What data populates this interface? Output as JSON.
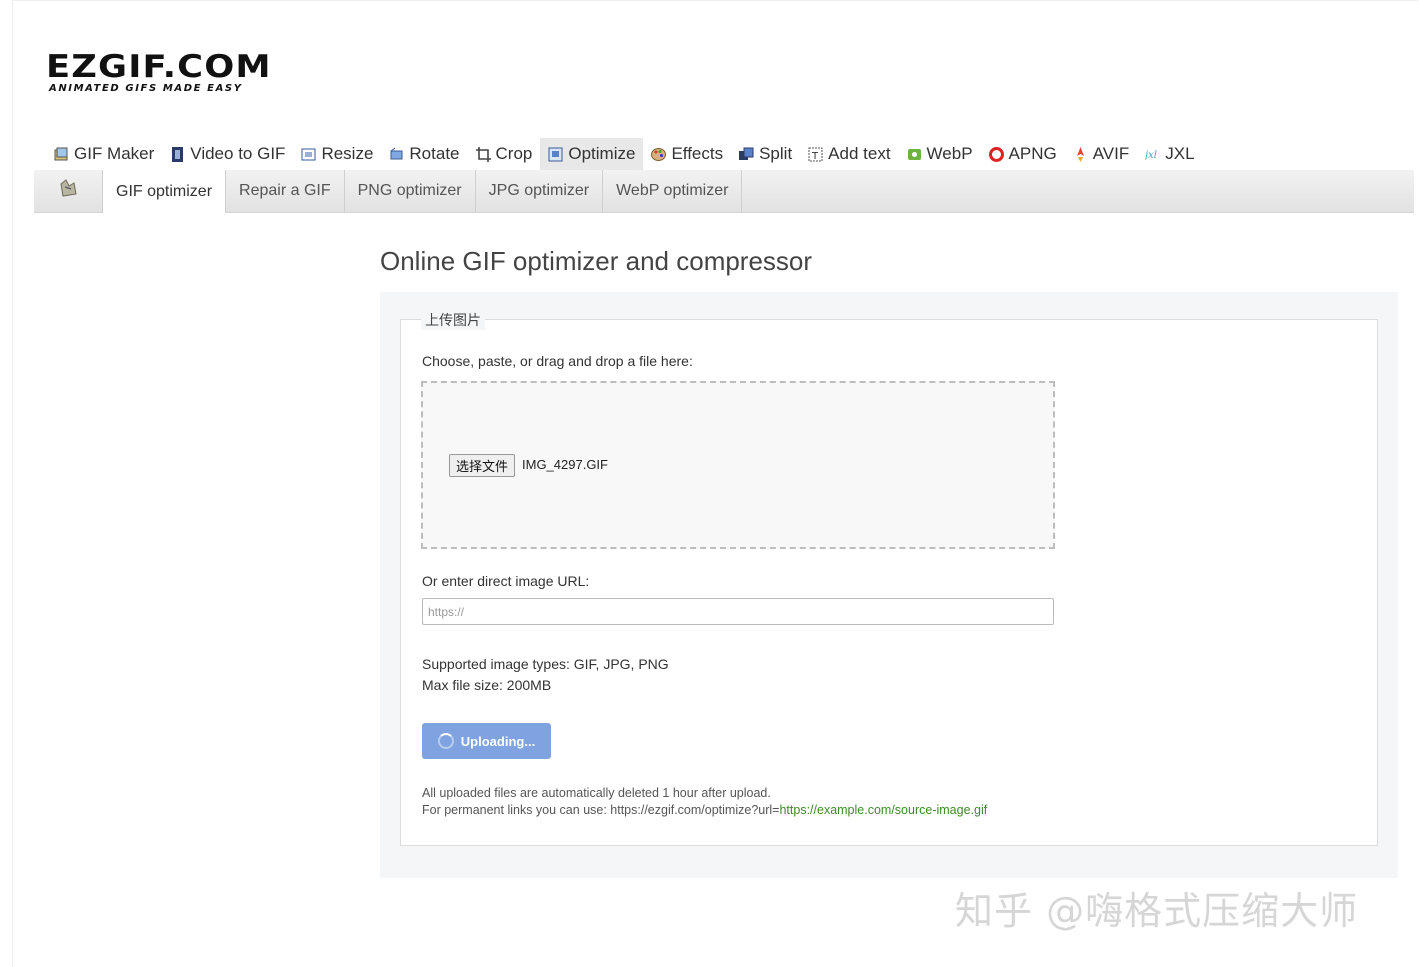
{
  "logo": {
    "main": "EZGIF.COM",
    "sub": "ANIMATED GIFS MADE EASY"
  },
  "nav": [
    {
      "label": "GIF Maker",
      "icon": "gif-maker-icon"
    },
    {
      "label": "Video to GIF",
      "icon": "film-icon"
    },
    {
      "label": "Resize",
      "icon": "resize-icon"
    },
    {
      "label": "Rotate",
      "icon": "rotate-icon"
    },
    {
      "label": "Crop",
      "icon": "crop-icon"
    },
    {
      "label": "Optimize",
      "icon": "optimize-icon",
      "active": true
    },
    {
      "label": "Effects",
      "icon": "palette-icon"
    },
    {
      "label": "Split",
      "icon": "split-icon"
    },
    {
      "label": "Add text",
      "icon": "add-text-icon"
    },
    {
      "label": "WebP",
      "icon": "webp-icon"
    },
    {
      "label": "APNG",
      "icon": "apng-icon"
    },
    {
      "label": "AVIF",
      "icon": "avif-icon"
    },
    {
      "label": "JXL",
      "icon": "jxl-icon"
    }
  ],
  "subnav": [
    {
      "label": "GIF optimizer",
      "active": true
    },
    {
      "label": "Repair a GIF"
    },
    {
      "label": "PNG optimizer"
    },
    {
      "label": "JPG optimizer"
    },
    {
      "label": "WebP optimizer"
    }
  ],
  "page_title": "Online GIF optimizer and compressor",
  "form": {
    "legend": "上传图片",
    "choose_label": "Choose, paste, or drag and drop a file here:",
    "file_button": "选择文件",
    "file_name": "IMG_4297.GIF",
    "url_label": "Or enter direct image URL:",
    "url_placeholder": "https://",
    "supported": "Supported image types: GIF, JPG, PNG",
    "max_size": "Max file size: 200MB",
    "upload_button": "Uploading...",
    "note1": "All uploaded files are automatically deleted 1 hour after upload.",
    "note2_prefix": "For permanent links you can use: https://ezgif.com/optimize?url=",
    "note2_link": "https://example.com/source-image.gif"
  },
  "watermark": "知乎 @嗨格式压缩大师",
  "colors": {
    "upload_button": "#7fa3e0",
    "link_green": "#3e8a29",
    "active_tab": "#e8e8e8"
  }
}
